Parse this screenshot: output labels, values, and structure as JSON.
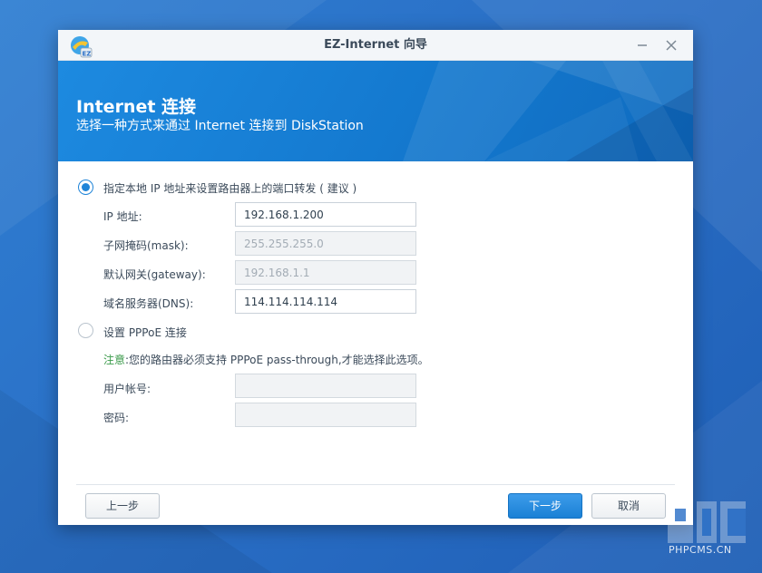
{
  "window": {
    "title": "EZ-Internet 向导"
  },
  "banner": {
    "title": "Internet 连接",
    "subtitle": "选择一种方式来通过 Internet 连接到 DiskStation"
  },
  "option_static": {
    "label": "指定本地 IP 地址来设置路由器上的端口转发 ( 建议 )",
    "selected": true,
    "fields": {
      "ip": {
        "label": "IP 地址:",
        "value": "192.168.1.200",
        "enabled": true
      },
      "mask": {
        "label": "子网掩码(mask):",
        "value": "255.255.255.0",
        "enabled": false
      },
      "gateway": {
        "label": "默认网关(gateway):",
        "value": "192.168.1.1",
        "enabled": false
      },
      "dns": {
        "label": "域名服务器(DNS):",
        "value": "114.114.114.114",
        "enabled": true
      }
    }
  },
  "option_pppoe": {
    "label": "设置 PPPoE 连接",
    "selected": false,
    "note_prefix": "注意",
    "note_text": ":您的路由器必须支持 PPPoE pass-through,才能选择此选项。",
    "fields": {
      "user": {
        "label": "用户帐号:",
        "value": "",
        "enabled": false
      },
      "password": {
        "label": "密码:",
        "value": "",
        "enabled": false
      }
    }
  },
  "footer": {
    "prev_label": "上一步",
    "next_label": "下一步",
    "cancel_label": "取消"
  },
  "watermark": {
    "text": "PHPCMS.CN"
  },
  "colors": {
    "desktop": "#2a6fc6",
    "banner": "#1479cf",
    "primary_button": "#1f84d8",
    "note_highlight": "#3a9a4a"
  }
}
